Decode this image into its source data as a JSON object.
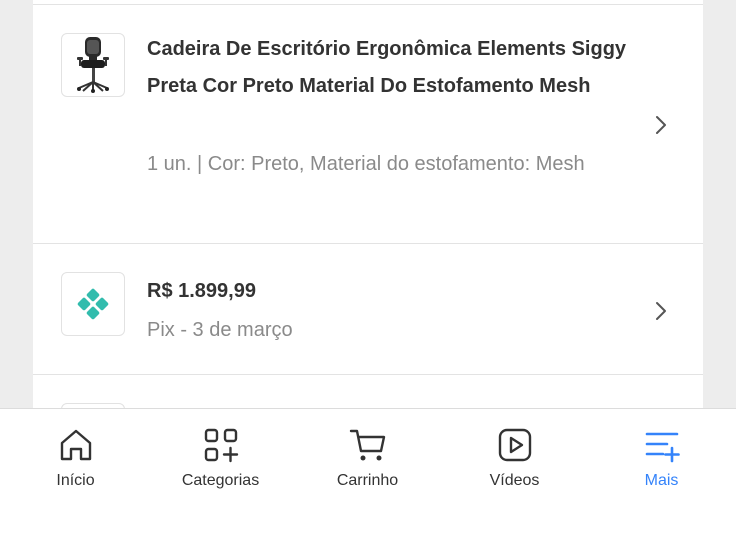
{
  "order_items": [
    {
      "title": "Cadeira De Escritório Ergonômica Elements Siggy Preta Cor Preto Material Do Estofamento Mesh",
      "details": "1 un. | Cor: Preto, Material do estofamento: Mesh",
      "thumbnail": "office-chair-image"
    }
  ],
  "payment": {
    "amount": "R$ 1.899,99",
    "method_date": "Pix - 3 de março",
    "icon": "pix-icon"
  },
  "tabbar": {
    "items": [
      {
        "label": "Início",
        "icon": "home-icon",
        "active": false
      },
      {
        "label": "Categorias",
        "icon": "categories-icon",
        "active": false
      },
      {
        "label": "Carrinho",
        "icon": "cart-icon",
        "active": false
      },
      {
        "label": "Vídeos",
        "icon": "video-icon",
        "active": false
      },
      {
        "label": "Mais",
        "icon": "menu-plus-icon",
        "active": true
      }
    ]
  },
  "colors": {
    "accent": "#3483fa",
    "pix": "#32bcad",
    "text": "#333333",
    "muted": "#8a8a8a",
    "background": "#ededed"
  }
}
